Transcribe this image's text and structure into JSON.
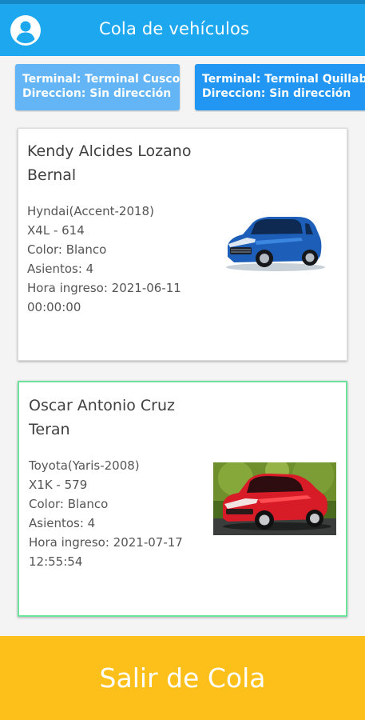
{
  "app": {
    "title": "Cola de vehículos",
    "avatar_icon": "account-circle-icon"
  },
  "terminals": [
    {
      "name": "Terminal: Terminal Cusco",
      "address": "Direccion: Sin dirección"
    },
    {
      "name": "Terminal: Terminal Quillabamba",
      "address": "Direccion: Sin dirección"
    }
  ],
  "queue": [
    {
      "driver": "Kendy Alcides Lozano Bernal",
      "vehicle": "Hyndai(Accent-2018)",
      "plate": "X4L - 614",
      "color": "Color: Blanco",
      "seats": "Asientos: 4",
      "entry_time": "Hora ingreso: 2021-06-11 00:00:00",
      "image": "blue-suv-photo",
      "selected": false
    },
    {
      "driver": "Oscar Antonio Cruz Teran",
      "vehicle": "Toyota(Yaris-2008)",
      "plate": "X1K - 579",
      "color": "Color: Blanco",
      "seats": "Asientos: 4",
      "entry_time": "Hora ingreso: 2021-07-17 12:55:54",
      "image": "red-hatchback-photo",
      "selected": true
    }
  ],
  "actions": {
    "exit_label": "Salir de Cola"
  },
  "colors": {
    "appbar": "#1ca7ef",
    "chip_light": "#64b5f6",
    "chip_dark": "#2196f3",
    "selected_border": "#6ee3a0",
    "exit_button": "#fdc01a"
  }
}
